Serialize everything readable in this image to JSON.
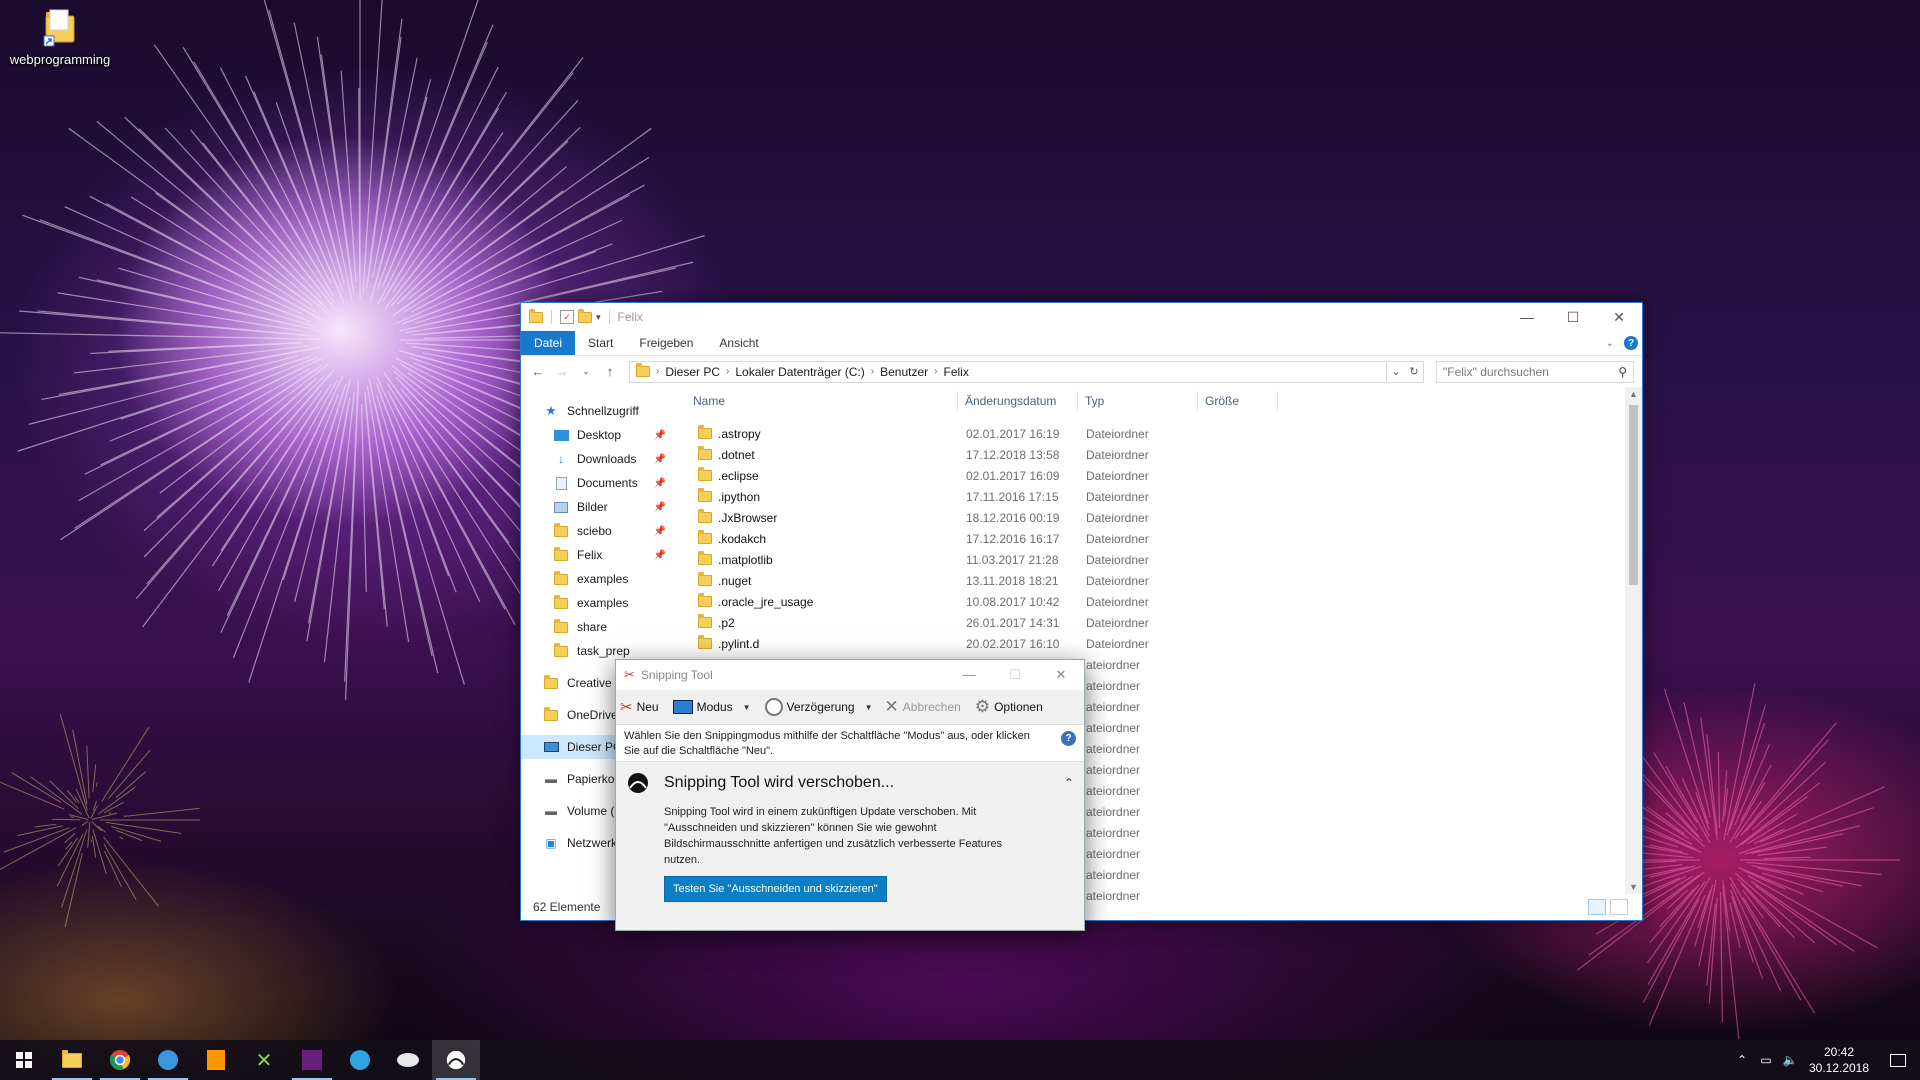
{
  "desktop": {
    "icons": [
      {
        "label": "webprogramming",
        "icon": "folder-shortcut-icon"
      }
    ]
  },
  "explorer": {
    "title": "Felix",
    "ribbon_tabs": [
      "Datei",
      "Start",
      "Freigeben",
      "Ansicht"
    ],
    "breadcrumb": [
      "Dieser PC",
      "Lokaler Datenträger (C:)",
      "Benutzer",
      "Felix"
    ],
    "search_placeholder": "\"Felix\" durchsuchen",
    "columns": {
      "name": "Name",
      "date": "Änderungsdatum",
      "type": "Typ",
      "size": "Größe"
    },
    "nav": {
      "quick_access": "Schnellzugriff",
      "pinned": [
        {
          "label": "Desktop",
          "icon": "desktop-icon"
        },
        {
          "label": "Downloads",
          "icon": "download-icon"
        },
        {
          "label": "Documents",
          "icon": "documents-icon"
        },
        {
          "label": "Bilder",
          "icon": "pictures-icon"
        },
        {
          "label": "sciebo",
          "icon": "synced-folder-icon"
        },
        {
          "label": "Felix",
          "icon": "folder-icon"
        }
      ],
      "recent": [
        {
          "label": "examples",
          "icon": "synced-folder-icon"
        },
        {
          "label": "examples",
          "icon": "synced-folder-icon"
        },
        {
          "label": "share",
          "icon": "synced-folder-icon"
        },
        {
          "label": "task_prep",
          "icon": "synced-folder-icon"
        }
      ],
      "roots": [
        {
          "label": "Creative C",
          "icon": "creative-cloud-icon"
        },
        {
          "label": "OneDrive",
          "icon": "onedrive-icon"
        },
        {
          "label": "Dieser PC",
          "icon": "this-pc-icon"
        },
        {
          "label": "Papierkor",
          "icon": "recycle-bin-icon"
        },
        {
          "label": "Volume (C",
          "icon": "drive-icon"
        },
        {
          "label": "Netzwerk",
          "icon": "network-icon"
        }
      ]
    },
    "files": [
      {
        "name": ".astropy",
        "date": "02.01.2017 16:19",
        "type": "Dateiordner"
      },
      {
        "name": ".dotnet",
        "date": "17.12.2018 13:58",
        "type": "Dateiordner"
      },
      {
        "name": ".eclipse",
        "date": "02.01.2017 16:09",
        "type": "Dateiordner"
      },
      {
        "name": ".ipython",
        "date": "17.11.2016 17:15",
        "type": "Dateiordner"
      },
      {
        "name": ".JxBrowser",
        "date": "18.12.2016 00:19",
        "type": "Dateiordner"
      },
      {
        "name": ".kodakch",
        "date": "17.12.2016 16:17",
        "type": "Dateiordner"
      },
      {
        "name": ".matplotlib",
        "date": "11.03.2017 21:28",
        "type": "Dateiordner"
      },
      {
        "name": ".nuget",
        "date": "13.11.2018 18:21",
        "type": "Dateiordner"
      },
      {
        "name": ".oracle_jre_usage",
        "date": "10.08.2017 10:42",
        "type": "Dateiordner"
      },
      {
        "name": ".p2",
        "date": "26.01.2017 14:31",
        "type": "Dateiordner"
      },
      {
        "name": ".pylint.d",
        "date": "20.02.2017 16:10",
        "type": "Dateiordner"
      }
    ],
    "hidden_rows_type": [
      "ateiordner",
      "ateiordner",
      "ateiordner",
      "ateiordner",
      "ateiordner",
      "ateiordner",
      "ateiordner",
      "ateiordner",
      "ateiordner",
      "ateiordner",
      "ateiordner",
      "ateiordner"
    ],
    "status": "62 Elemente"
  },
  "snipping_tool": {
    "title": "Snipping Tool",
    "toolbar": {
      "new": "Neu",
      "mode": "Modus",
      "delay": "Verzögerung",
      "cancel": "Abbrechen",
      "options": "Optionen"
    },
    "hint": "Wählen Sie den Snippingmodus mithilfe der Schaltfläche \"Modus\" aus, oder klicken Sie auf die Schaltfläche \"Neu\".",
    "notice_title": "Snipping Tool wird verschoben...",
    "notice_text": "Snipping Tool wird in einem zukünftigen Update verschoben. Mit \"Ausschneiden und skizzieren\" können Sie wie gewohnt Bildschirmausschnitte anfertigen und zusätzlich verbesserte Features nutzen.",
    "notice_button": "Testen Sie \"Ausschneiden und skizzieren\""
  },
  "taskbar": {
    "apps": [
      "start-icon",
      "file-explorer-icon",
      "chrome-icon",
      "edge-icon",
      "sublime-icon",
      "xmind-icon",
      "visual-studio-icon",
      "telegram-icon",
      "java-icon",
      "snipping-tool-icon"
    ],
    "time": "20:42",
    "date": "30.12.2018"
  },
  "colors": {
    "accent": "#1979ca",
    "selection": "#cce8ff",
    "folder": "#f6cf5b"
  }
}
